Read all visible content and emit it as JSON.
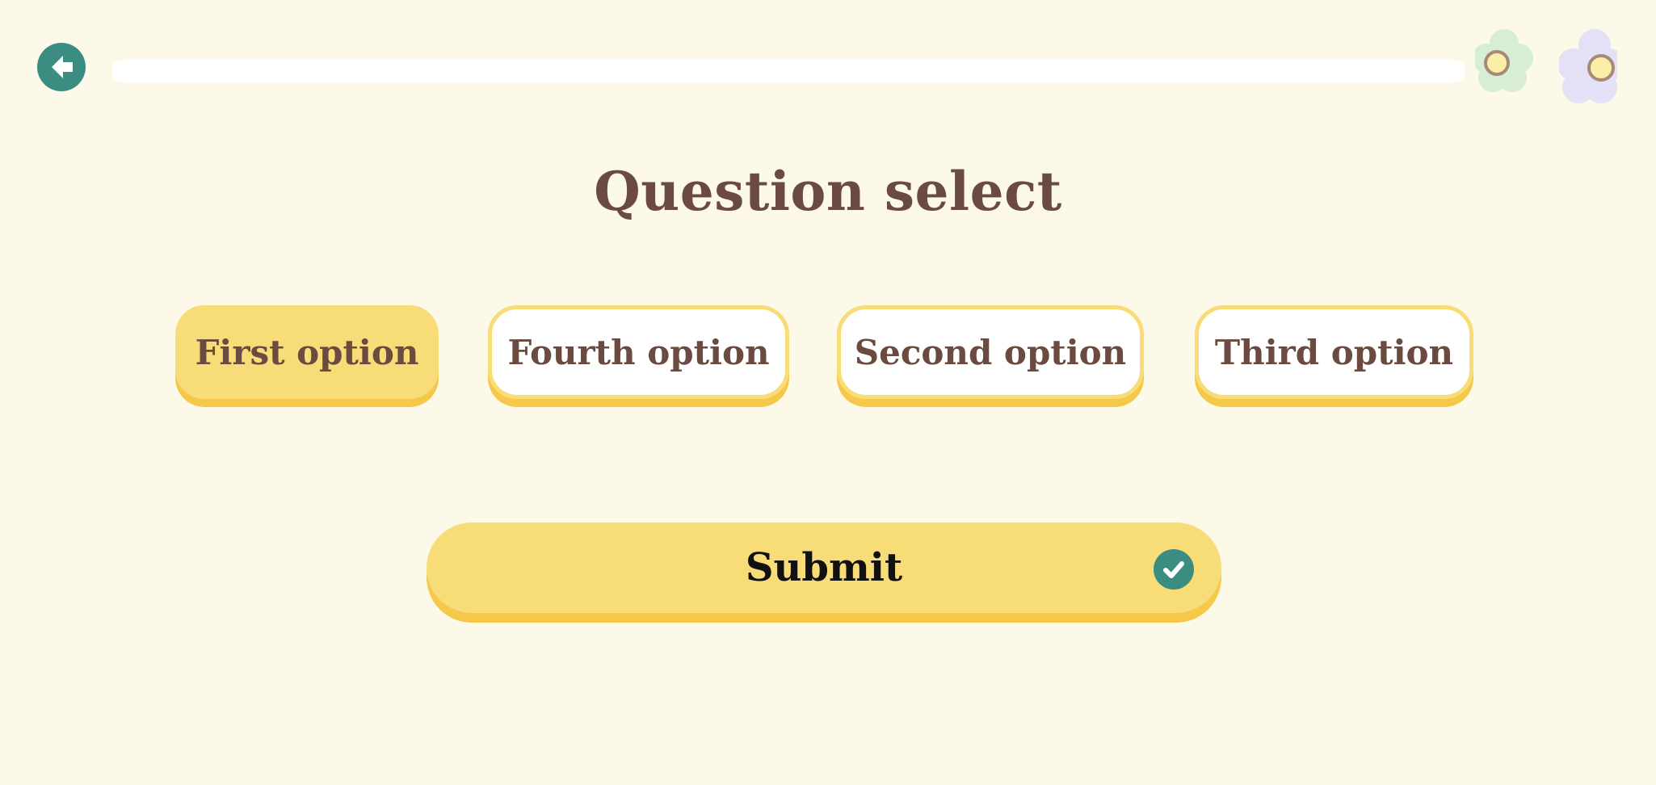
{
  "header": {
    "back_icon": "arrow-left-icon",
    "progress_fraction": 0.0,
    "decorations": [
      "green-flower-icon",
      "purple-flower-icon"
    ]
  },
  "question": {
    "title": "Question select"
  },
  "options": [
    {
      "label": "First option",
      "selected": true
    },
    {
      "label": "Fourth option",
      "selected": false
    },
    {
      "label": "Second option",
      "selected": false
    },
    {
      "label": "Third option",
      "selected": false
    }
  ],
  "submit": {
    "label": "Submit",
    "icon": "checkmark-icon"
  },
  "colors": {
    "background": "#fdf9e9",
    "accent_yellow": "#f8dc78",
    "accent_yellow_shadow": "#f5c84a",
    "teal": "#3a8d80",
    "text_brown": "#6b4a3f"
  }
}
